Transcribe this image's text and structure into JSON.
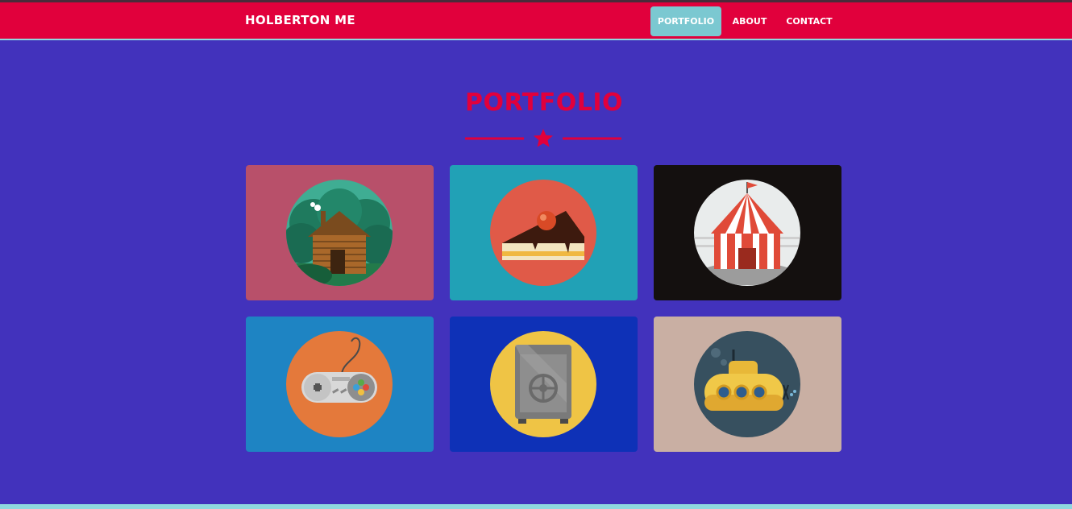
{
  "navbar": {
    "brand": "HOLBERTON ME",
    "links": [
      {
        "label": "PORTFOLIO",
        "active": true
      },
      {
        "label": "ABOUT",
        "active": false
      },
      {
        "label": "CONTACT",
        "active": false
      }
    ]
  },
  "portfolio": {
    "title": "PORTFOLIO",
    "divider_icon": "star-icon",
    "items": [
      {
        "icon": "cabin-icon",
        "background": "#b8506a",
        "circle": "#3fad93"
      },
      {
        "icon": "cake-icon",
        "background": "#21a1b6",
        "circle": "#e05a48"
      },
      {
        "icon": "circus-tent-icon",
        "background": "#14100f",
        "circle": "#e9ecec"
      },
      {
        "icon": "game-controller-icon",
        "background": "#1e84c3",
        "circle": "#e4793b"
      },
      {
        "icon": "safe-icon",
        "background": "#0e31b7",
        "circle": "#efc445"
      },
      {
        "icon": "submarine-icon",
        "background": "#c9afa3",
        "circle": "#37505f"
      }
    ]
  },
  "colors": {
    "page_background": "#4232bc",
    "navbar": "#e1003c",
    "accent": "#7bc8d1",
    "title": "#e1003c"
  }
}
